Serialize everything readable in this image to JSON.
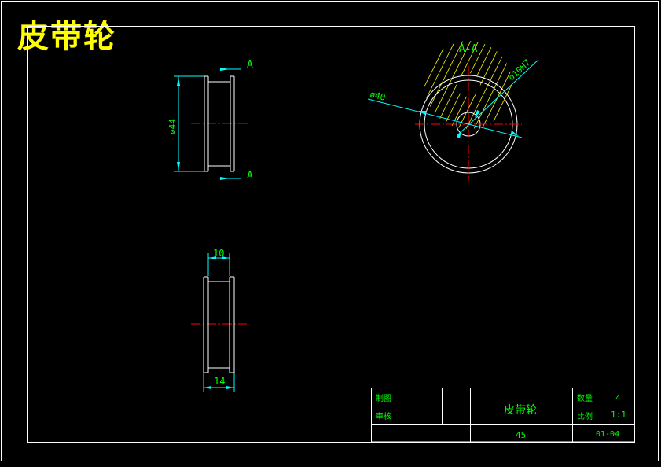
{
  "sheet_title": "皮带轮",
  "front_view": {
    "section_mark": "A",
    "section_mark_bottom": "A",
    "diameter_dim": "ø44"
  },
  "section_view": {
    "label": "A-A",
    "outer_dim": "ø40",
    "bore_dim": "ø10H7"
  },
  "side_view": {
    "top_dim": "10",
    "bottom_dim": "14"
  },
  "title_block": {
    "drawn_label": "制图",
    "checked_label": "审核",
    "part_name": "皮带轮",
    "qty_label": "数量",
    "qty_value": "4",
    "scale_label": "比例",
    "scale_value": "1:1",
    "material": "45",
    "drawing_no": "01-04"
  },
  "colors": {
    "background": "#000000",
    "geometry": "#ffffff",
    "dimension": "#00ffff",
    "text": "#00ff00",
    "center_line": "#ff0000",
    "hatch": "#ffff00",
    "title": "#ffff00"
  }
}
